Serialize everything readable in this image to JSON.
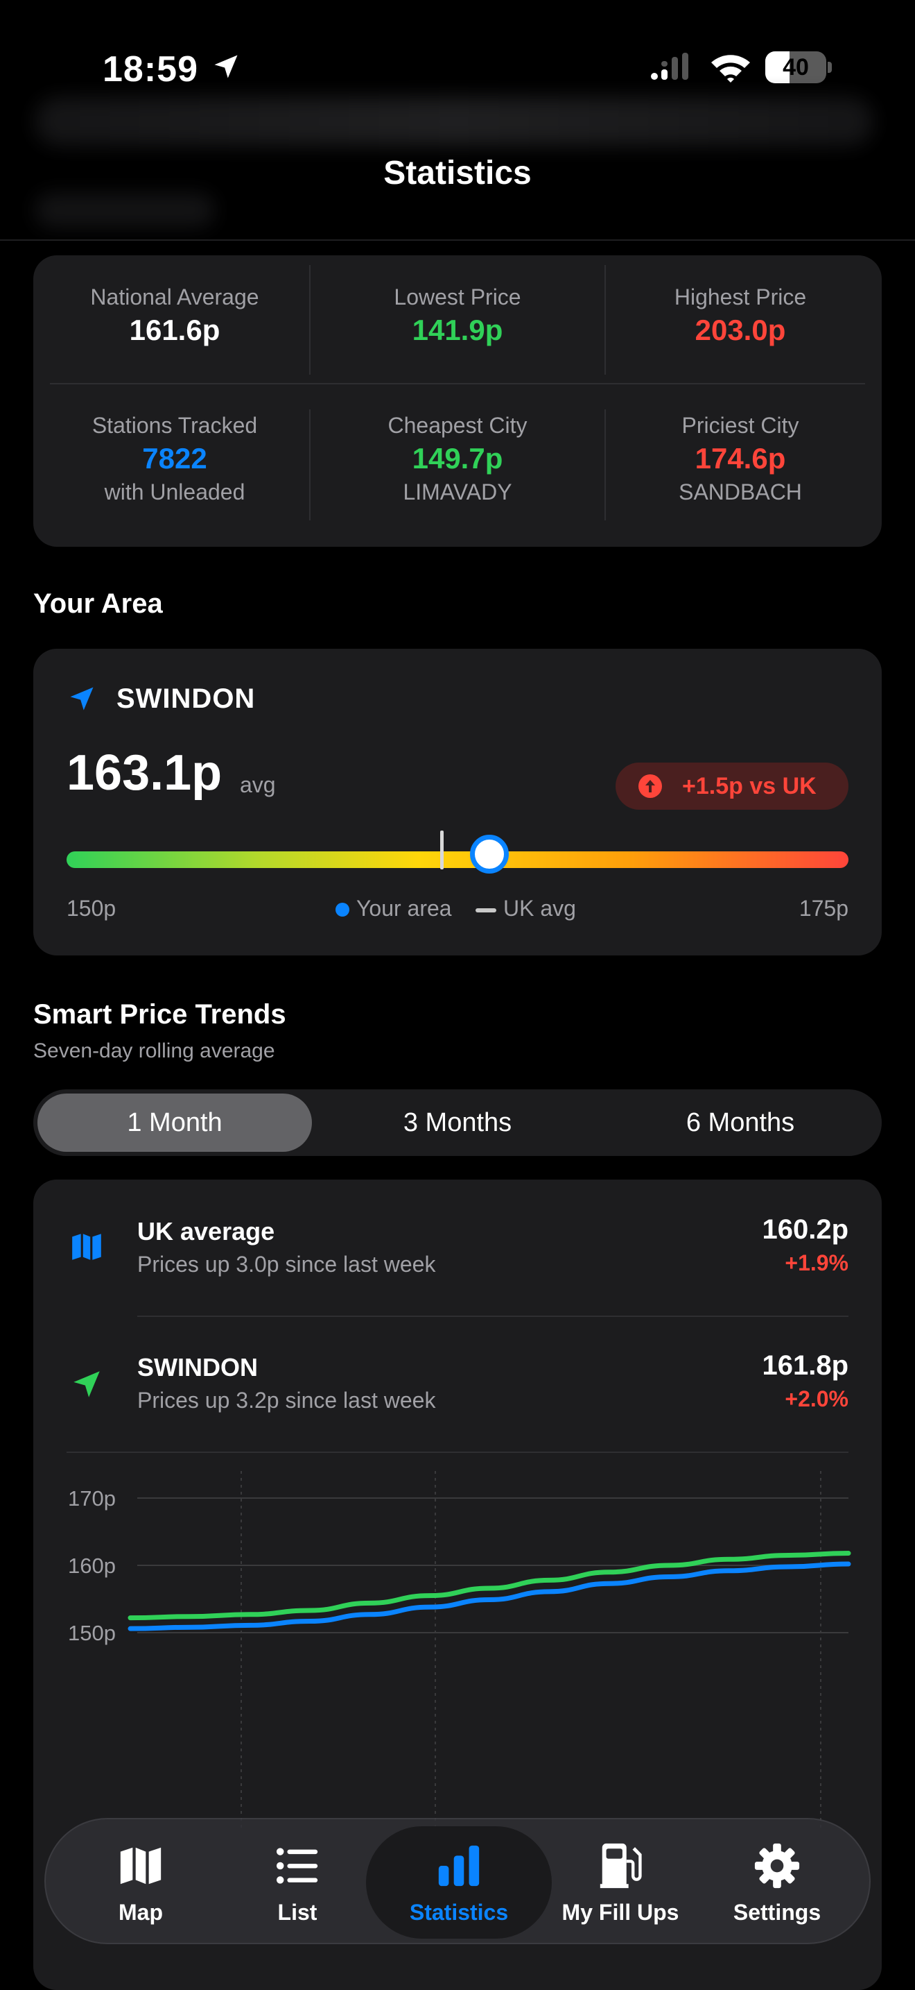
{
  "status_bar": {
    "time": "18:59",
    "battery": "40",
    "battery_level": 0.4
  },
  "header": {
    "title": "Statistics"
  },
  "stats": {
    "national_average": {
      "label": "National Average",
      "value": "161.6p"
    },
    "lowest_price": {
      "label": "Lowest Price",
      "value": "141.9p"
    },
    "highest_price": {
      "label": "Highest Price",
      "value": "203.0p"
    },
    "stations_tracked": {
      "label": "Stations Tracked",
      "value": "7822",
      "sub": "with Unleaded"
    },
    "cheapest_city": {
      "label": "Cheapest City",
      "value": "149.7p",
      "sub": "LIMAVADY"
    },
    "priciest_city": {
      "label": "Priciest City",
      "value": "174.6p",
      "sub": "SANDBACH"
    }
  },
  "your_area": {
    "section_title": "Your Area",
    "name": "SWINDON",
    "price": "163.1p",
    "avg_label": "avg",
    "diff": "+1.5p vs UK",
    "scale_min": "150p",
    "scale_max": "175p",
    "legend_area": "Your area",
    "legend_uk": "UK avg"
  },
  "trends": {
    "title": "Smart Price Trends",
    "subtitle": "Seven-day rolling average",
    "tabs": [
      "1 Month",
      "3 Months",
      "6 Months"
    ],
    "active_tab": 0,
    "uk": {
      "name": "UK average",
      "desc": "Prices up 3.0p since last week",
      "price": "160.2p",
      "pct": "+1.9%"
    },
    "area": {
      "name": "SWINDON",
      "desc": "Prices up 3.2p since last week",
      "price": "161.8p",
      "pct": "+2.0%"
    }
  },
  "chart_data": {
    "type": "line",
    "ylim": [
      145,
      172
    ],
    "y_ticks": [
      "170p",
      "160p",
      "150p"
    ],
    "y_tick_values": [
      170,
      160,
      150
    ],
    "x": [
      0,
      1,
      2,
      3,
      4,
      5,
      6,
      7,
      8,
      9,
      10,
      11,
      12
    ],
    "series": [
      {
        "name": "SWINDON",
        "color": "#30d158",
        "values": [
          152.2,
          152.4,
          152.7,
          153.3,
          154.4,
          155.5,
          156.6,
          157.8,
          159.0,
          160.0,
          160.9,
          161.5,
          161.8
        ]
      },
      {
        "name": "UK average",
        "color": "#0a84ff",
        "values": [
          150.6,
          150.8,
          151.1,
          151.7,
          152.7,
          153.8,
          154.9,
          156.1,
          157.3,
          158.3,
          159.2,
          159.8,
          160.2
        ]
      }
    ]
  },
  "tabbar": {
    "items": [
      {
        "label": "Map",
        "icon": "map-icon"
      },
      {
        "label": "List",
        "icon": "list-icon"
      },
      {
        "label": "Statistics",
        "icon": "chart-bar-icon"
      },
      {
        "label": "My Fill Ups",
        "icon": "fuel-pump-icon"
      },
      {
        "label": "Settings",
        "icon": "gear-icon"
      }
    ],
    "active": 2
  },
  "colors": {
    "green": "#30d158",
    "red": "#ff453a",
    "blue": "#0a84ff",
    "card": "#1c1c1e"
  }
}
